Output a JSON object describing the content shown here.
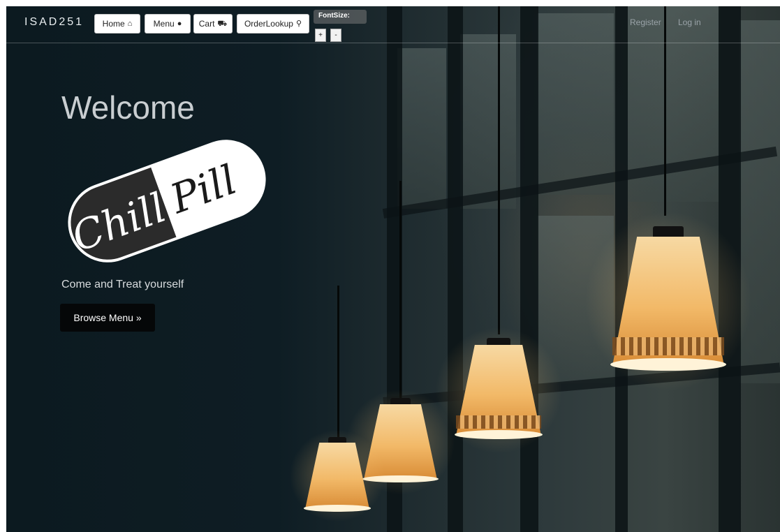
{
  "navbar": {
    "brand": "ISAD251",
    "buttons": [
      {
        "label": "Home",
        "icon": "home-icon",
        "glyph": "⌂"
      },
      {
        "label": "Menu",
        "icon": "apple-icon",
        "glyph": "●"
      },
      {
        "label": "Cart",
        "icon": "cart-icon",
        "glyph": "⛟"
      },
      {
        "label": "OrderLookup",
        "icon": "search-icon",
        "glyph": "⚲"
      }
    ],
    "font_size": {
      "label": "FontSize:",
      "increase": "+",
      "decrease": "-"
    },
    "links": {
      "register": "Register",
      "login": "Log in"
    }
  },
  "hero": {
    "heading": "Welcome",
    "logo_text_left": "Chill",
    "logo_text_right": "Pill",
    "tagline": "Come and Treat yourself",
    "cta": "Browse Menu »"
  },
  "colors": {
    "background": "#0e1d24",
    "button_bg": "#ffffff",
    "cta_bg": "#050708",
    "lamp_glow": "#f2b968"
  }
}
